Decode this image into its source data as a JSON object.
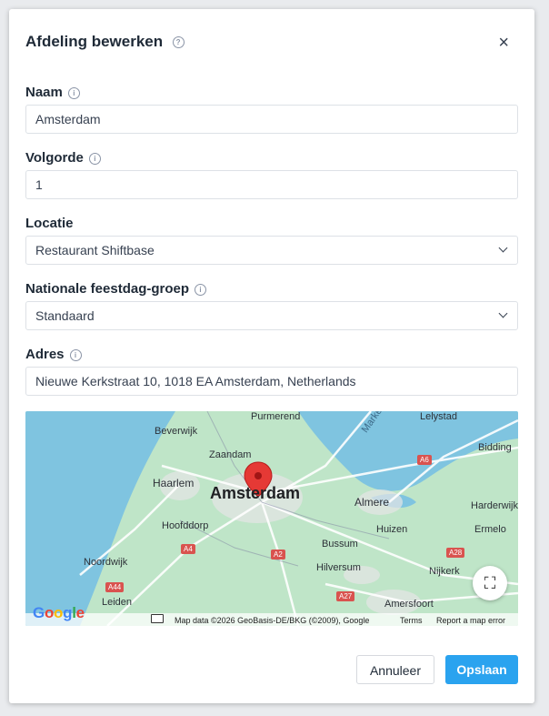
{
  "modal": {
    "title": "Afdeling bewerken",
    "close_icon": "×"
  },
  "fields": {
    "naam": {
      "label": "Naam",
      "value": "Amsterdam"
    },
    "volgorde": {
      "label": "Volgorde",
      "value": "1"
    },
    "locatie": {
      "label": "Locatie",
      "value": "Restaurant Shiftbase"
    },
    "feestdag": {
      "label": "Nationale feestdag-groep",
      "value": "Standaard"
    },
    "adres": {
      "label": "Adres",
      "value": "Nieuwe Kerkstraat 10, 1018 EA Amsterdam, Netherlands"
    }
  },
  "map": {
    "labels": {
      "purmerend": "Purmerend",
      "lelystad": "Lelystad",
      "beverwijk": "Beverwijk",
      "zaandam": "Zaandam",
      "haarlem": "Haarlem",
      "amsterdam": "Amsterdam",
      "almere": "Almere",
      "harderwijk": "Harderwijk",
      "hoofddorp": "Hoofddorp",
      "huizen": "Huizen",
      "ermelo": "Ermelo",
      "bussum": "Bussum",
      "noordwijk": "Noordwijk",
      "hilversum": "Hilversum",
      "nijkerk": "Nijkerk",
      "leiden": "Leiden",
      "amersfoort": "Amersfoort",
      "bidding": "Bidding",
      "markermeer": "Marke"
    },
    "roads": [
      "A6",
      "A4",
      "A2",
      "A28",
      "A44",
      "A27"
    ],
    "google": "Google",
    "attribution": "Map data ©2026 GeoBasis-DE/BKG (©2009), Google",
    "terms": "Terms",
    "report": "Report a map error",
    "fullscreen_icon": "⛶"
  },
  "buttons": {
    "cancel": "Annuleer",
    "save": "Opslaan"
  }
}
